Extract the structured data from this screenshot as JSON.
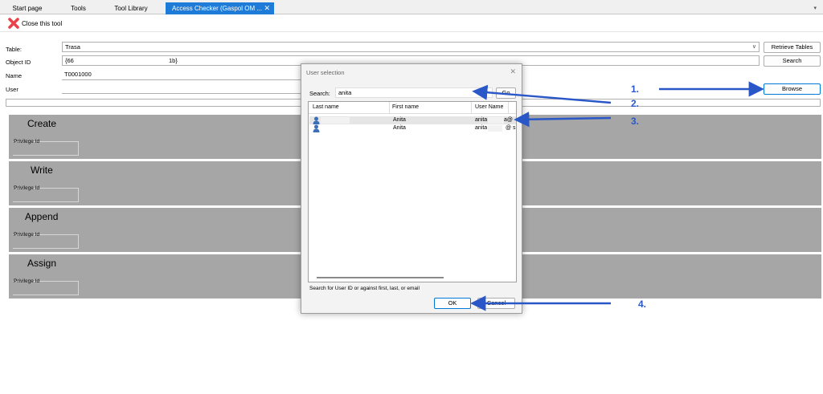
{
  "tabs": [
    "Start page",
    "Tools",
    "Tool Library",
    "Access Checker (Gaspol OM ..."
  ],
  "tab_close_glyph": "✕",
  "tab_dropdown_glyph": "▾",
  "toolbar": {
    "close_tool_label": "Close this tool",
    "close_icon": "red-x-icon"
  },
  "form": {
    "table_label": "Table:",
    "table_value": "Trasa",
    "object_id_label": "Object ID",
    "object_id_part1": "{66",
    "object_id_part2": "1b}",
    "name_label": "Name",
    "name_value": "T0001000",
    "user_label": "User",
    "retrieve_tables_button": "Retrieve Tables",
    "search_button": "Search",
    "browse_button": "Browse"
  },
  "privileges": [
    {
      "title": "Create",
      "id_label": "Privilege Id"
    },
    {
      "title": "Write",
      "id_label": "Privilege Id"
    },
    {
      "title": "Append",
      "id_label": "Privilege Id"
    },
    {
      "title": "Assign",
      "id_label": "Privilege Id"
    }
  ],
  "dialog": {
    "title": "User selection",
    "search_label": "Search:",
    "search_value": "anita",
    "go_button": "Go",
    "columns": [
      "Last name",
      "First name",
      "User Name"
    ],
    "rows": [
      {
        "last_name": "",
        "first_name": "Anita",
        "user_name": "anita",
        "user_name_tail": "a@",
        "icon": "user-icon"
      },
      {
        "last_name": "",
        "first_name": "Anita",
        "user_name": "anita",
        "user_name_tail": "@ s",
        "icon": "user-icon"
      }
    ],
    "hint": "Search for User ID or against first, last, or email",
    "ok_button": "OK",
    "cancel_button": "Cancel"
  },
  "annotations": {
    "labels": [
      "1.",
      "2.",
      "3.",
      "4."
    ],
    "color": "#2a57c8"
  },
  "colors": {
    "accent": "#1e7bd7",
    "privilege_panel": "#a6a6a6",
    "annotation": "#2a57c8"
  }
}
